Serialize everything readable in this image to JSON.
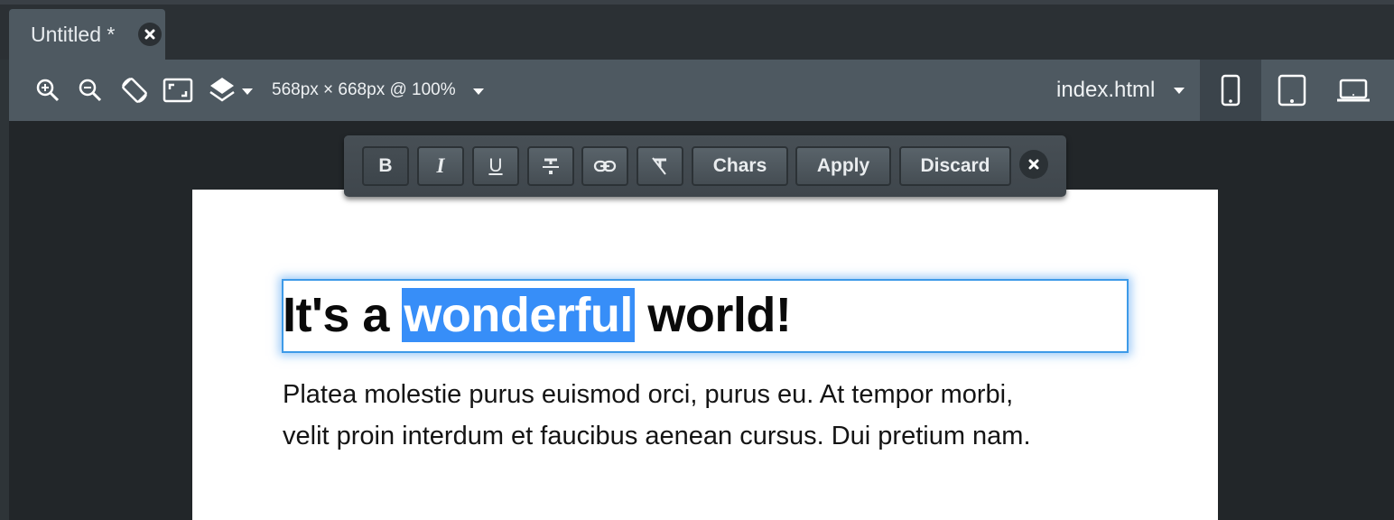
{
  "tab": {
    "title": "Untitled *",
    "close_icon": "close-icon"
  },
  "toolbar": {
    "icons": [
      "zoom-in-icon",
      "zoom-out-icon",
      "rotate-device-icon",
      "fit-screen-icon",
      "layers-icon"
    ],
    "viewport_size": "568px × 668px @ 100%",
    "file": "index.html",
    "devices": [
      {
        "name": "phone",
        "active": true
      },
      {
        "name": "tablet",
        "active": false
      },
      {
        "name": "laptop",
        "active": false
      }
    ]
  },
  "format_bar": {
    "buttons": [
      {
        "label": "B",
        "name": "bold"
      },
      {
        "label": "I",
        "name": "italic"
      },
      {
        "label": "U",
        "name": "underline"
      },
      {
        "label": "S",
        "name": "strikethrough"
      },
      {
        "label": "link",
        "name": "link"
      },
      {
        "label": "Tx",
        "name": "clear-format"
      }
    ],
    "chars_label": "Chars",
    "apply_label": "Apply",
    "discard_label": "Discard"
  },
  "document": {
    "heading_before": "It's a ",
    "heading_selected": "wonderful",
    "heading_after": " world!",
    "paragraph_line1": "Platea molestie purus euismod orci, purus eu. At tempor morbi,",
    "paragraph_line2": "velit proin interdum et faucibus aenean cursus. Dui pretium nam."
  },
  "colors": {
    "selection": "#378ef8",
    "focus_outline": "#3d9ae8"
  }
}
